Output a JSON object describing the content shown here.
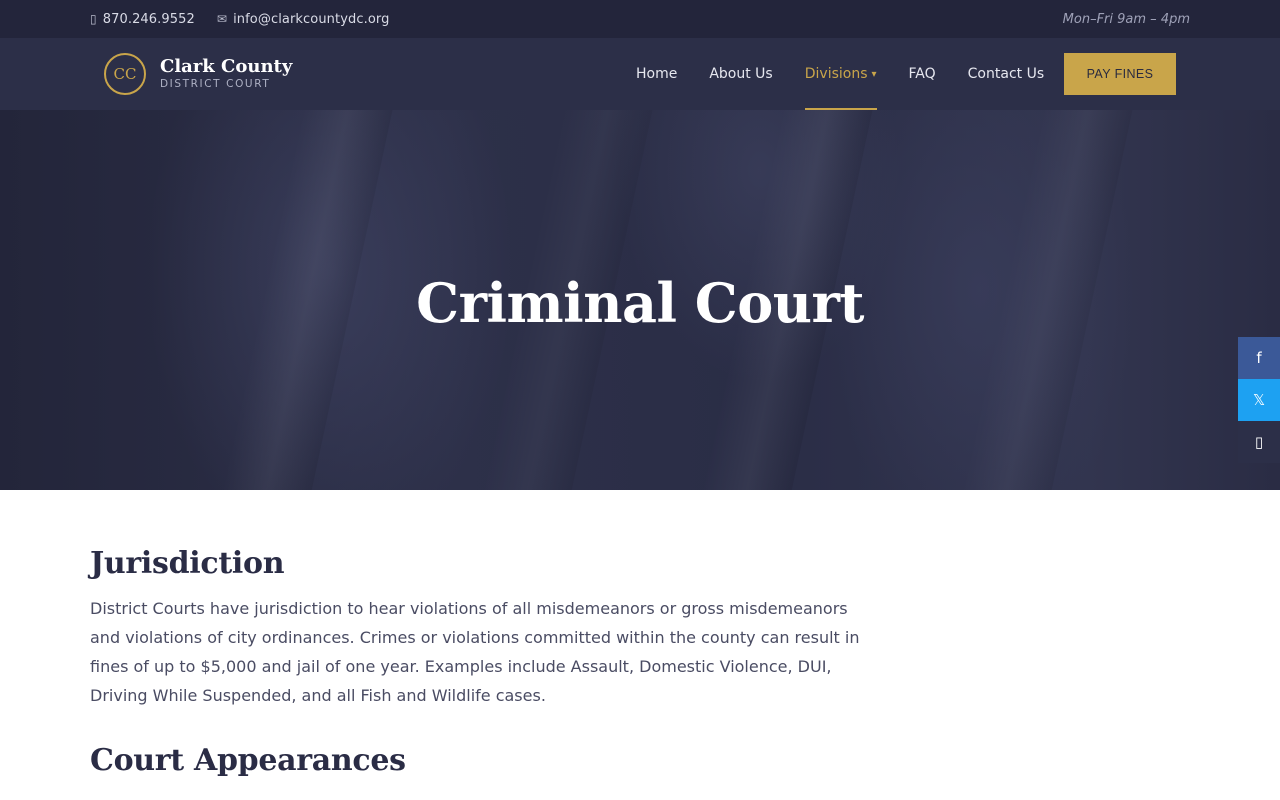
{
  "topbar": {
    "phone_icon": "phone-icon",
    "phone": "870.246.9552",
    "email_icon": "envelope-icon",
    "email": "info@clarkcountydc.org",
    "hours": "Mon–Fri 9am – 4pm"
  },
  "header": {
    "logo_mark": "CC",
    "logo_name": "Clark County",
    "logo_sub": "DISTRICT COURT",
    "nav": [
      "Home",
      "About Us",
      "Divisions",
      "FAQ",
      "Contact Us"
    ],
    "active_nav": "Divisions",
    "divisions_caret": "▾",
    "pay_button": "PAY FINES"
  },
  "hero": {
    "title": "Criminal Court"
  },
  "social": {
    "facebook": "f",
    "twitter": "𝕏",
    "phone": "▯"
  },
  "content": {
    "jurisdiction_heading": "Jurisdiction",
    "jurisdiction_text": "District Courts have jurisdiction to hear violations of all misdemeanors or gross misdemeanors and violations of city ordinances. Crimes or violations committed within the county can result in fines of up to $5,000 and jail of one year. Examples include Assault, Domestic Violence, DUI, Driving While Suspended, and all Fish and Wildlife cases.",
    "appearances_heading": "Court Appearances"
  },
  "colors": {
    "topbar_bg": "#23253b",
    "header_bg": "#2c2f48",
    "accent_gold": "#c9a54a",
    "facebook_blue": "#3b5998",
    "twitter_blue": "#1da1f2"
  }
}
